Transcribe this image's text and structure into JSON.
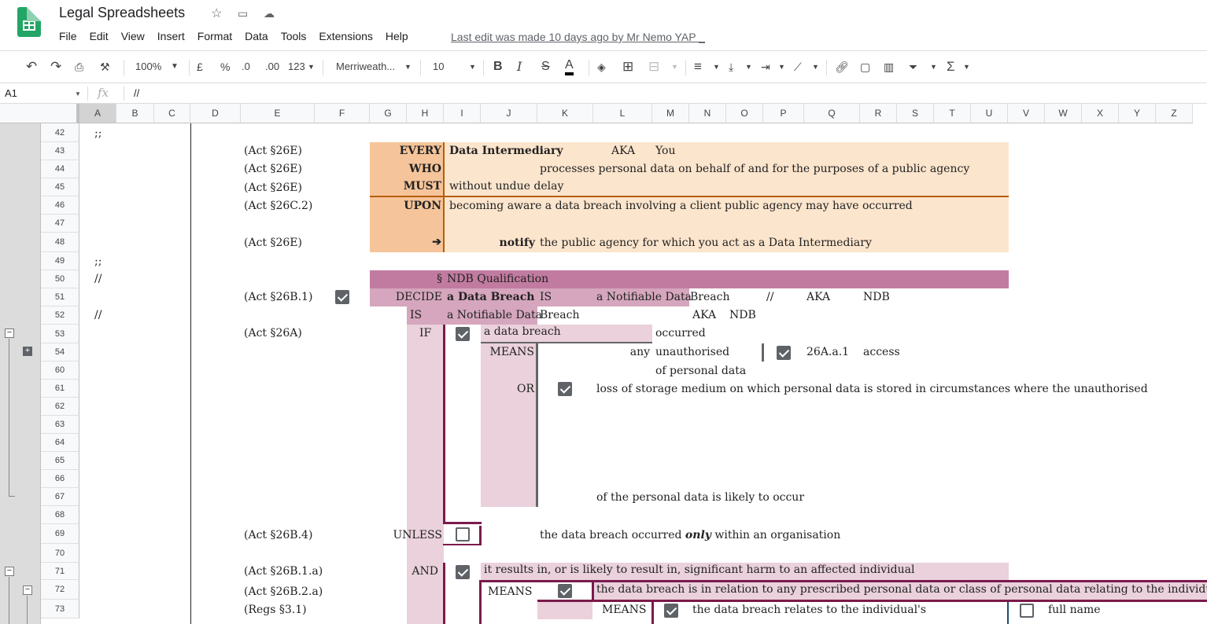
{
  "app": {
    "title": "Legal Spreadsheets",
    "last_edit": "Last edit was made 10 days ago by Mr Nemo YAP _"
  },
  "menu": [
    "File",
    "Edit",
    "View",
    "Insert",
    "Format",
    "Data",
    "Tools",
    "Extensions",
    "Help"
  ],
  "toolbar": {
    "zoom": "100%",
    "currency": "£",
    "percent": "%",
    "dec_less": ".0",
    "dec_more": ".00",
    "format_more": "123",
    "font": "Merriweath...",
    "font_size": "10",
    "bold": "B",
    "italic": "I",
    "strike": "S",
    "text_color": "A"
  },
  "formula_bar": {
    "cell_ref": "A1",
    "fx": "fx",
    "value": "//"
  },
  "columns": [
    "A",
    "B",
    "C",
    "D",
    "E",
    "F",
    "G",
    "H",
    "I",
    "J",
    "K",
    "L",
    "M",
    "N",
    "O",
    "P",
    "Q",
    "R",
    "S",
    "T",
    "U",
    "V",
    "W",
    "X",
    "Y",
    "Z"
  ],
  "rows": [
    "42",
    "43",
    "44",
    "45",
    "46",
    "47",
    "48",
    "49",
    "50",
    "51",
    "52",
    "53",
    "54",
    "60",
    "61",
    "62",
    "63",
    "64",
    "65",
    "66",
    "67",
    "68",
    "69",
    "70",
    "71",
    "72",
    "73"
  ],
  "colors": {
    "orange_dark": "#f6c49a",
    "orange_light": "#fce5cd",
    "orange_line": "#b45f06",
    "pink_dark": "#c27ba0",
    "pink_mid": "#d5a6bd",
    "pink_light": "#ead1dc",
    "plum_line": "#741b47",
    "green": "#23a566"
  },
  "cells": {
    "r42a": ";;",
    "r43e": "(Act §26E)",
    "r43h": "EVERY",
    "r43j": "Data Intermediary",
    "r43l": "AKA",
    "r43m": "You",
    "r44e": "(Act §26E)",
    "r44h": "WHO",
    "r44k": "processes personal data on behalf of and for the purposes of a public agency",
    "r45e": "(Act §26E)",
    "r45h": "MUST",
    "r45j": "without undue delay",
    "r46e": "(Act §26C.2)",
    "r46h": "UPON",
    "r46j": "becoming aware a data breach involving a client public agency may have occurred",
    "r48e": "(Act §26E)",
    "r48h": "➔",
    "r48j": "notify",
    "r48k": "the public agency for which you act as a Data Intermediary",
    "r49a": ";;",
    "r50a": "//",
    "r50h": "§",
    "r50i": "NDB Qualification",
    "r51e": "(Act §26B.1)",
    "r51h": "DECIDE",
    "r51i": "a Data Breach",
    "r51k": "IS",
    "r51l": "a Notifiable Data",
    "r51n": "Breach",
    "r51o": "//",
    "r51q": "AKA",
    "r51r": "NDB",
    "r52a": "//",
    "r52h": "IS",
    "r52i": "a Notifiable Data",
    "r52k": "Breach",
    "r52n": "AKA",
    "r52o": "NDB",
    "r53e": "(Act §26A)",
    "r53h": "IF",
    "r53j": "a data breach",
    "r53m": "occurred",
    "r54j": "MEANS",
    "r54l": "any",
    "r54m": "unauthorised",
    "r54q": "26A.a.1",
    "r54r": "access",
    "r60m": "of personal data",
    "r61j": "OR",
    "r61l": "loss of storage medium on which personal data is stored in circumstances where the unauthorised",
    "r67l": "of the personal data is likely to occur",
    "r69e": "(Act §26B.4)",
    "r69h": "UNLESS",
    "r69k": "the data breach occurred",
    "r69k_em": "only",
    "r69k2": "within an organisation",
    "r71e": "(Act §26B.1.a)",
    "r71h": "AND",
    "r71j": "it results in, or is likely to result in, significant harm to an affected individual",
    "r72e": "(Act §26B.2.a)",
    "r72j": "MEANS",
    "r72l": "the data breach is in relation to any prescribed personal data or class of personal data relating to the individual",
    "r73e": "(Regs §3.1)",
    "r73l": "MEANS",
    "r73n": "the data breach relates to the individual's",
    "r73w": "full name"
  }
}
